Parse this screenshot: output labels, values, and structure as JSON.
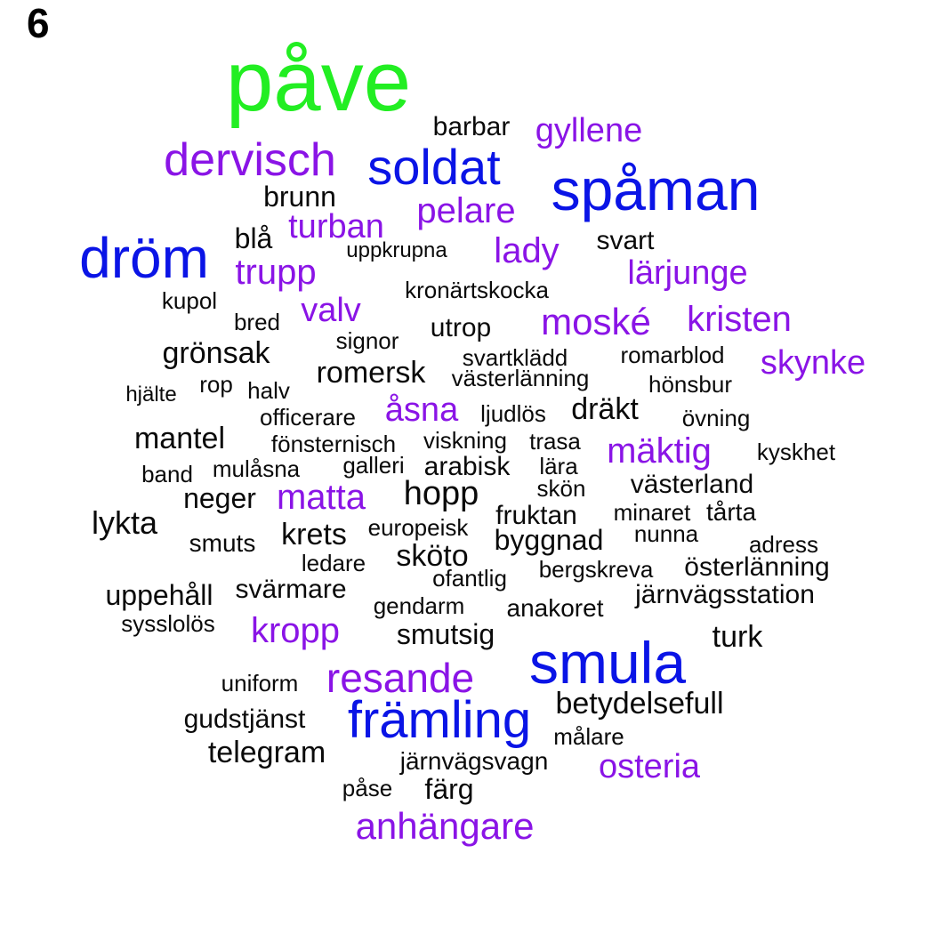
{
  "panel_label": "6",
  "colors": {
    "green": "#22ee22",
    "blue": "#0a14e6",
    "purple": "#8a14e6",
    "black": "#0a0a0a"
  },
  "words": [
    "påve",
    "barbar",
    "gyllene",
    "dervisch",
    "soldat",
    "spåman",
    "brunn",
    "pelare",
    "turban",
    "blå",
    "dröm",
    "uppkrupna",
    "lady",
    "svart",
    "trupp",
    "lärjunge",
    "kupol",
    "kronärtskocka",
    "valv",
    "bred",
    "moské",
    "kristen",
    "signor",
    "utrop",
    "grönsak",
    "svartklädd",
    "romarblod",
    "skynke",
    "romersk",
    "rop",
    "hjälte",
    "halv",
    "västerlänning",
    "hönsbur",
    "åsna",
    "officerare",
    "ljudlös",
    "dräkt",
    "övning",
    "mantel",
    "fönsternisch",
    "viskning",
    "trasa",
    "mäktig",
    "kyskhet",
    "band",
    "mulåsna",
    "galleri",
    "arabisk",
    "lära",
    "hopp",
    "skön",
    "västerland",
    "neger",
    "matta",
    "lykta",
    "fruktan",
    "minaret",
    "tårta",
    "europeisk",
    "smuts",
    "krets",
    "byggnad",
    "nunna",
    "adress",
    "sköto",
    "ledare",
    "bergskreva",
    "österlänning",
    "ofantlig",
    "uppehåll",
    "svärmare",
    "järnvägsstation",
    "gendarm",
    "anakoret",
    "sysslolös",
    "kropp",
    "smutsig",
    "turk",
    "smula",
    "uniform",
    "resande",
    "betydelsefull",
    "främling",
    "gudstjänst",
    "målare",
    "telegram",
    "järnvägsvagn",
    "osteria",
    "påse",
    "färg",
    "anhängare"
  ]
}
